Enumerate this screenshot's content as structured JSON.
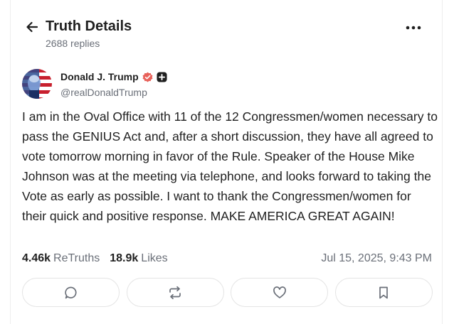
{
  "header": {
    "title": "Truth Details",
    "replies": "2688 replies",
    "back_icon": "arrow-left-icon",
    "more_icon": "more-horizontal-icon"
  },
  "author": {
    "name": "Donald J. Trump",
    "handle": "@realDonaldTrump",
    "verified_color": "#e8615a",
    "avatar": "flag-portrait-avatar"
  },
  "post": {
    "text": "I am in the Oval Office with 11 of the 12 Congressmen/women necessary to pass the GENIUS Act and, after a short discussion, they have all agreed to vote tomorrow morning in favor of the Rule. Speaker of the House Mike Johnson was at the meeting via telephone, and looks forward to taking the Vote as early as possible. I want to thank the Congressmen/women for their quick and positive response. MAKE AMERICA GREAT AGAIN!",
    "retruths_count": "4.46k",
    "retruths_label": "ReTruths",
    "likes_count": "18.9k",
    "likes_label": "Likes",
    "timestamp": "Jul 15, 2025, 9:43 PM"
  },
  "actions": [
    {
      "name": "reply",
      "icon": "comment-icon"
    },
    {
      "name": "retruth",
      "icon": "retruth-icon"
    },
    {
      "name": "like",
      "icon": "heart-icon"
    },
    {
      "name": "bookmark",
      "icon": "bookmark-icon"
    }
  ]
}
